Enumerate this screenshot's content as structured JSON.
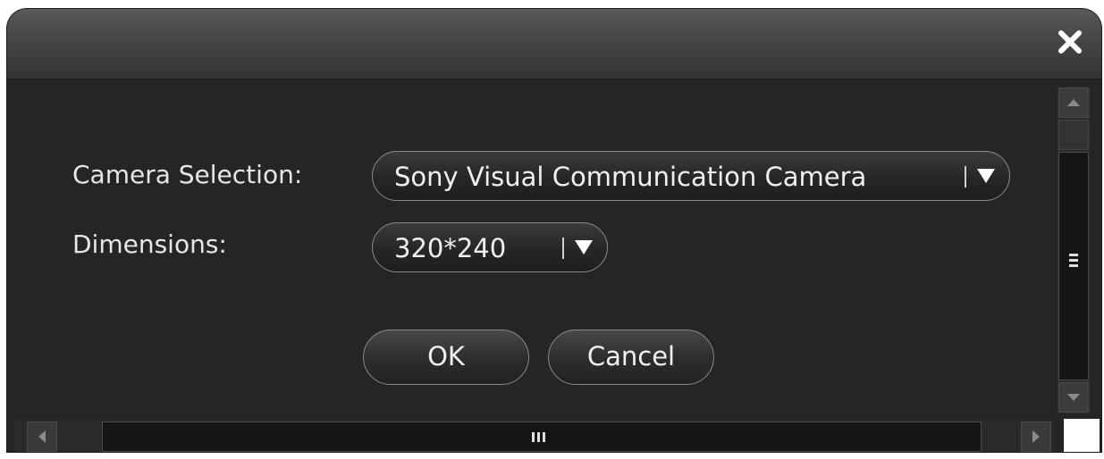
{
  "dialog": {
    "close_icon": "close-icon"
  },
  "form": {
    "camera_label": "Camera Selection:",
    "camera_value": "Sony Visual Communication Camera",
    "dimensions_label": "Dimensions:",
    "dimensions_value": "320*240"
  },
  "buttons": {
    "ok_label": "OK",
    "cancel_label": "Cancel"
  },
  "scrollbars": {
    "vertical_icons": [
      "scroll-up-arrow-icon",
      "grip-icon",
      "scroll-down-arrow-icon"
    ],
    "horizontal_icons": [
      "scroll-left-arrow-icon",
      "grip-icon",
      "scroll-right-arrow-icon"
    ]
  },
  "colors": {
    "background": "#252525",
    "titlebar": "#454545",
    "text": "#e6e6e6",
    "border": "#8a8a8a"
  }
}
